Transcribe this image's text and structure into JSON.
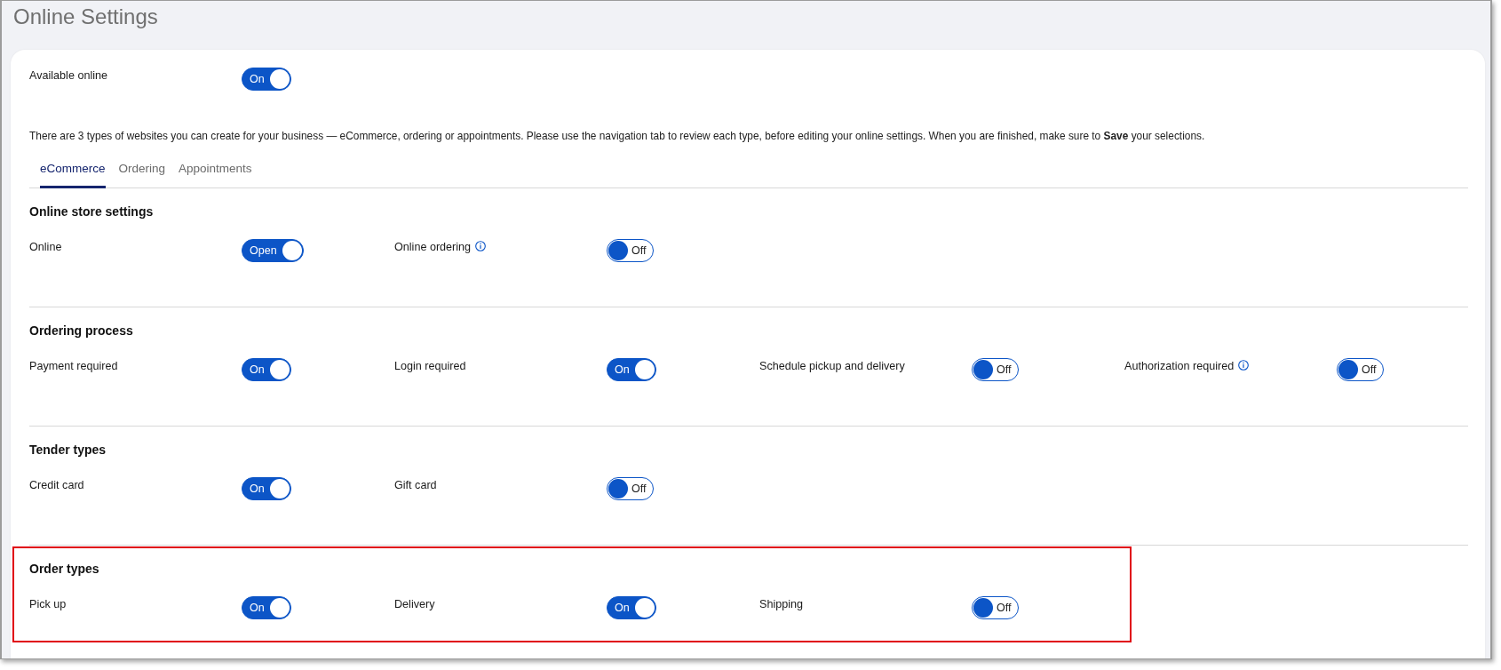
{
  "page": {
    "title": "Online Settings"
  },
  "available_online": {
    "label": "Available online",
    "toggle": {
      "on": true,
      "text": "On"
    }
  },
  "description": "There are 3 types of websites you can create for your business — eCommerce, ordering or appointments. Please use the navigation tab to review each type, before editing your online settings. When you are finished, make sure to **Save** your selections.",
  "tabs": [
    {
      "label": "eCommerce",
      "selected": true
    },
    {
      "label": "Ordering",
      "selected": false
    },
    {
      "label": "Appointments",
      "selected": false
    }
  ],
  "sections": [
    {
      "title": "Online store settings",
      "highlighted": false,
      "settings": [
        {
          "label": "Online",
          "info": false,
          "toggle": {
            "on": true,
            "text": "Open"
          }
        },
        {
          "label": "Online ordering",
          "info": true,
          "toggle": {
            "on": false,
            "text": "Off"
          }
        }
      ]
    },
    {
      "title": "Ordering process",
      "highlighted": false,
      "settings": [
        {
          "label": "Payment required",
          "info": false,
          "toggle": {
            "on": true,
            "text": "On"
          }
        },
        {
          "label": "Login required",
          "info": false,
          "toggle": {
            "on": true,
            "text": "On"
          }
        },
        {
          "label": "Schedule pickup and delivery",
          "info": false,
          "toggle": {
            "on": false,
            "text": "Off"
          }
        },
        {
          "label": "Authorization required",
          "info": true,
          "toggle": {
            "on": false,
            "text": "Off"
          }
        }
      ]
    },
    {
      "title": "Tender types",
      "highlighted": false,
      "settings": [
        {
          "label": "Credit card",
          "info": false,
          "toggle": {
            "on": true,
            "text": "On"
          }
        },
        {
          "label": "Gift card",
          "info": false,
          "toggle": {
            "on": false,
            "text": "Off"
          }
        }
      ]
    },
    {
      "title": "Order types",
      "highlighted": true,
      "settings": [
        {
          "label": "Pick up",
          "info": false,
          "toggle": {
            "on": true,
            "text": "On"
          }
        },
        {
          "label": "Delivery",
          "info": false,
          "toggle": {
            "on": true,
            "text": "On"
          }
        },
        {
          "label": "Shipping",
          "info": false,
          "toggle": {
            "on": false,
            "text": "Off"
          }
        }
      ]
    }
  ]
}
